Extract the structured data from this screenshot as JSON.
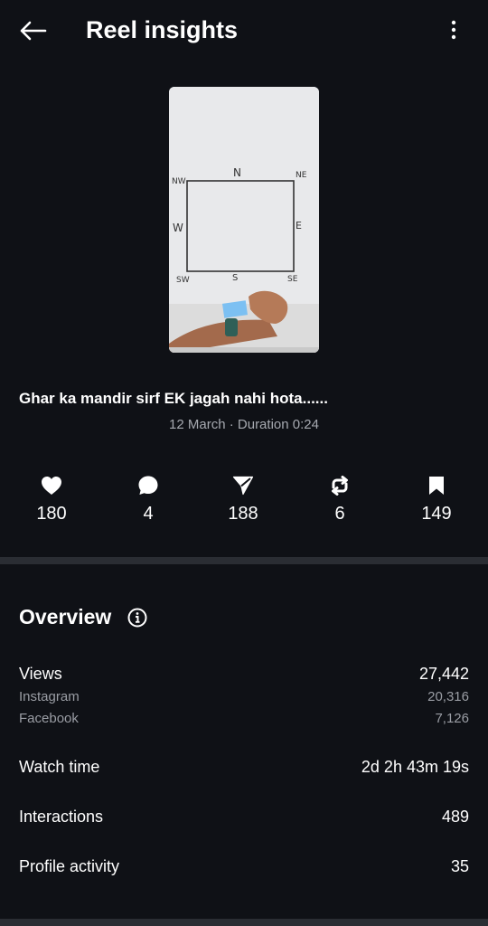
{
  "header": {
    "title": "Reel insights",
    "back_icon": "arrow-left-icon",
    "more_icon": "more-vertical-icon"
  },
  "reel": {
    "thumbnail_labels": {
      "nw": "NW",
      "n": "N",
      "ne": "NE",
      "w": "W",
      "e": "E",
      "sw": "SW",
      "s": "S",
      "se": "SE"
    },
    "caption": "Ghar ka mandir sirf EK jagah nahi hota......",
    "meta": "12 March · Duration 0:24"
  },
  "stats": [
    {
      "icon": "heart-icon",
      "value": "180"
    },
    {
      "icon": "comment-icon",
      "value": "4"
    },
    {
      "icon": "share-icon",
      "value": "188"
    },
    {
      "icon": "repost-icon",
      "value": "6"
    },
    {
      "icon": "bookmark-icon",
      "value": "149"
    }
  ],
  "overview": {
    "title": "Overview",
    "info_icon": "info-icon",
    "views": {
      "label": "Views",
      "value": "27,442"
    },
    "instagram": {
      "label": "Instagram",
      "value": "20,316"
    },
    "facebook": {
      "label": "Facebook",
      "value": "7,126"
    },
    "watch_time": {
      "label": "Watch time",
      "value": "2d 2h 43m 19s"
    },
    "interactions": {
      "label": "Interactions",
      "value": "489"
    },
    "profile_activity": {
      "label": "Profile activity",
      "value": "35"
    }
  },
  "colors": {
    "background": "#0f1116",
    "divider": "#2a2d33",
    "secondary_text": "#a6a9b0"
  }
}
